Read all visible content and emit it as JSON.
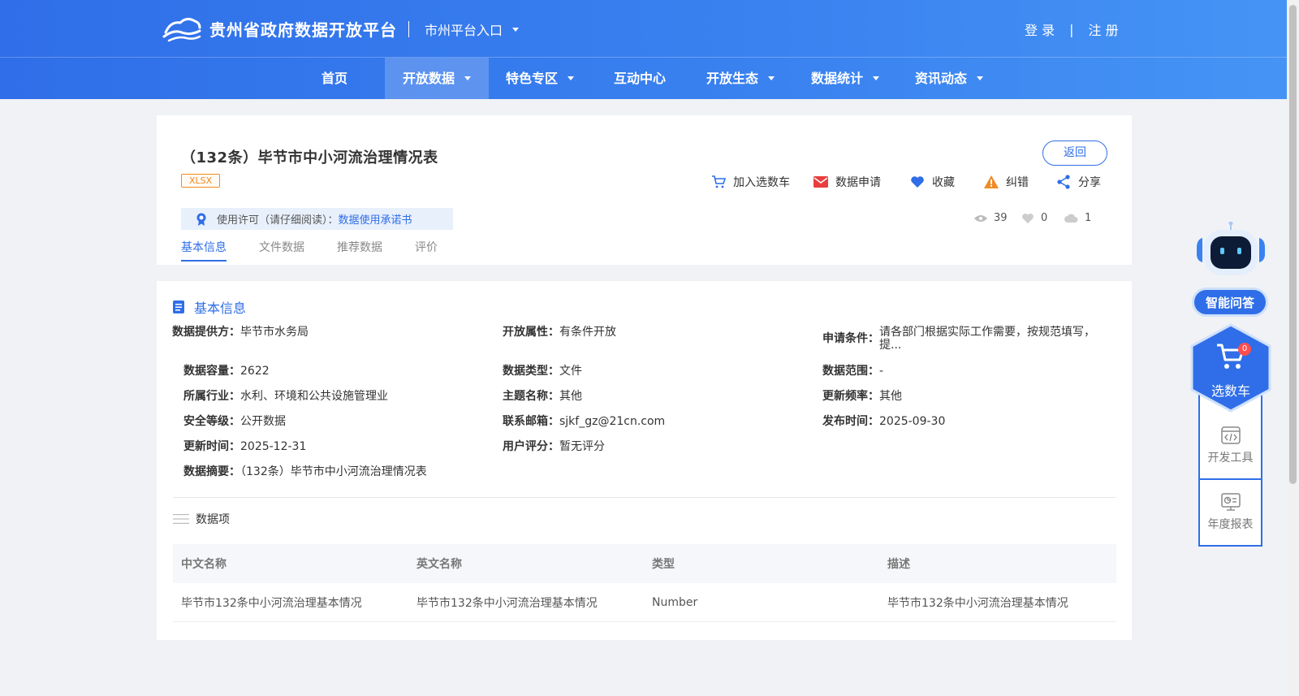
{
  "header": {
    "site_title": "贵州省政府数据开放平台",
    "city_entry": "市州平台入口",
    "login": "登 录",
    "separator": "|",
    "register": "注 册"
  },
  "nav": {
    "items": [
      {
        "label": "首页",
        "has_dropdown": false,
        "active": false
      },
      {
        "label": "开放数据",
        "has_dropdown": true,
        "active": true
      },
      {
        "label": "特色专区",
        "has_dropdown": true,
        "active": false
      },
      {
        "label": "互动中心",
        "has_dropdown": false,
        "active": false
      },
      {
        "label": "开放生态",
        "has_dropdown": true,
        "active": false
      },
      {
        "label": "数据统计",
        "has_dropdown": true,
        "active": false
      },
      {
        "label": "资讯动态",
        "has_dropdown": true,
        "active": false
      }
    ]
  },
  "dataset": {
    "title": "（132条）毕节市中小河流治理情况表",
    "format": "XLSX",
    "back_label": "返回",
    "actions": [
      "加入选数车",
      "数据申请",
      "收藏",
      "纠错",
      "分享"
    ],
    "license_label": "使用许可（请仔细阅读）：",
    "license_link": "数据使用承诺书",
    "views": "39",
    "likes": "0",
    "downloads": "1",
    "tabs": [
      "基本信息",
      "文件数据",
      "推荐数据",
      "评价"
    ],
    "active_tab": "基本信息"
  },
  "basic_info": {
    "section_title": "基本信息",
    "fields": {
      "provider": {
        "k": "数据提供方：",
        "v": "毕节市水务局"
      },
      "open_attr": {
        "k": "开放属性：",
        "v": "有条件开放"
      },
      "apply_cond": {
        "k": "申请条件：",
        "v": "请各部门根据实际工作需要，按规范填写，提..."
      },
      "capacity": {
        "k": "数据容量：",
        "v": "2622"
      },
      "data_type": {
        "k": "数据类型：",
        "v": "文件"
      },
      "data_range": {
        "k": "数据范围：",
        "v": "-"
      },
      "industry": {
        "k": "所属行业：",
        "v": "水利、环境和公共设施管理业"
      },
      "theme": {
        "k": "主题名称：",
        "v": "其他"
      },
      "frequency": {
        "k": "更新频率：",
        "v": "其他"
      },
      "security": {
        "k": "安全等级：",
        "v": "公开数据"
      },
      "email": {
        "k": "联系邮箱：",
        "v": "sjkf_gz@21cn.com"
      },
      "publish_time": {
        "k": "发布时间：",
        "v": "2025-09-30"
      },
      "update_time": {
        "k": "更新时间：",
        "v": "2025-12-31"
      },
      "rating": {
        "k": "用户评分：",
        "v": "暂无评分"
      },
      "summary": {
        "k": "数据摘要：",
        "v": "（132条）毕节市中小河流治理情况表"
      }
    }
  },
  "data_items": {
    "title": "数据项",
    "columns": [
      "中文名称",
      "英文名称",
      "类型",
      "描述"
    ],
    "rows": [
      [
        "毕节市132条中小河流治理基本情况",
        "毕节市132条中小河流治理基本情况",
        "Number",
        "毕节市132条中小河流治理基本情况"
      ]
    ]
  },
  "sidebar": {
    "qa_label": "智能问答",
    "cart_label": "选数车",
    "cart_count": "0",
    "dev_tools": "开发工具",
    "annual_report": "年度报表"
  },
  "colors": {
    "primary": "#2f6ee8",
    "badge": "#f08a24",
    "page_bg": "#f0f2f5"
  }
}
